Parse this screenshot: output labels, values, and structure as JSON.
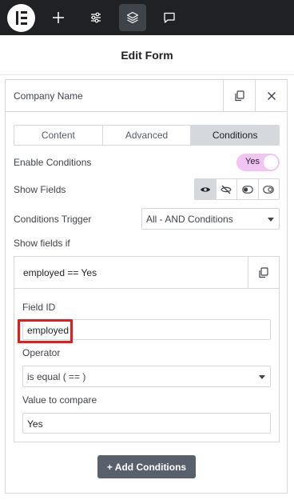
{
  "topbar": {
    "icons": [
      "elementor-logo-icon",
      "plus-icon",
      "sliders-icon",
      "layers-icon",
      "chat-icon"
    ]
  },
  "header": {
    "title": "Edit Form"
  },
  "widget": {
    "title": "Company Name"
  },
  "tabs": [
    {
      "label": "Content"
    },
    {
      "label": "Advanced"
    },
    {
      "label": "Conditions",
      "active": true
    }
  ],
  "enable_conditions": {
    "label": "Enable Conditions",
    "value": "Yes",
    "accent": "#f0c5f3"
  },
  "show_fields": {
    "label": "Show Fields",
    "options": [
      "eye-icon",
      "eye-slash-icon",
      "toggle-on-icon",
      "toggle-off-icon"
    ],
    "selected": 0
  },
  "conditions_trigger": {
    "label": "Conditions Trigger",
    "value": "All - AND Conditions"
  },
  "show_fields_if": {
    "label": "Show fields if"
  },
  "condition_item": {
    "title": "employed == Yes",
    "field_id": {
      "label": "Field ID",
      "value": "employed"
    },
    "operator": {
      "label": "Operator",
      "value": "is equal ( == )"
    },
    "value_to_compare": {
      "label": "Value to compare",
      "value": "Yes"
    }
  },
  "add_button": {
    "label": "+ Add Conditions"
  },
  "colors": {
    "highlight": "#e11d1d",
    "topbar": "#1f2124",
    "button": "#58616b"
  }
}
